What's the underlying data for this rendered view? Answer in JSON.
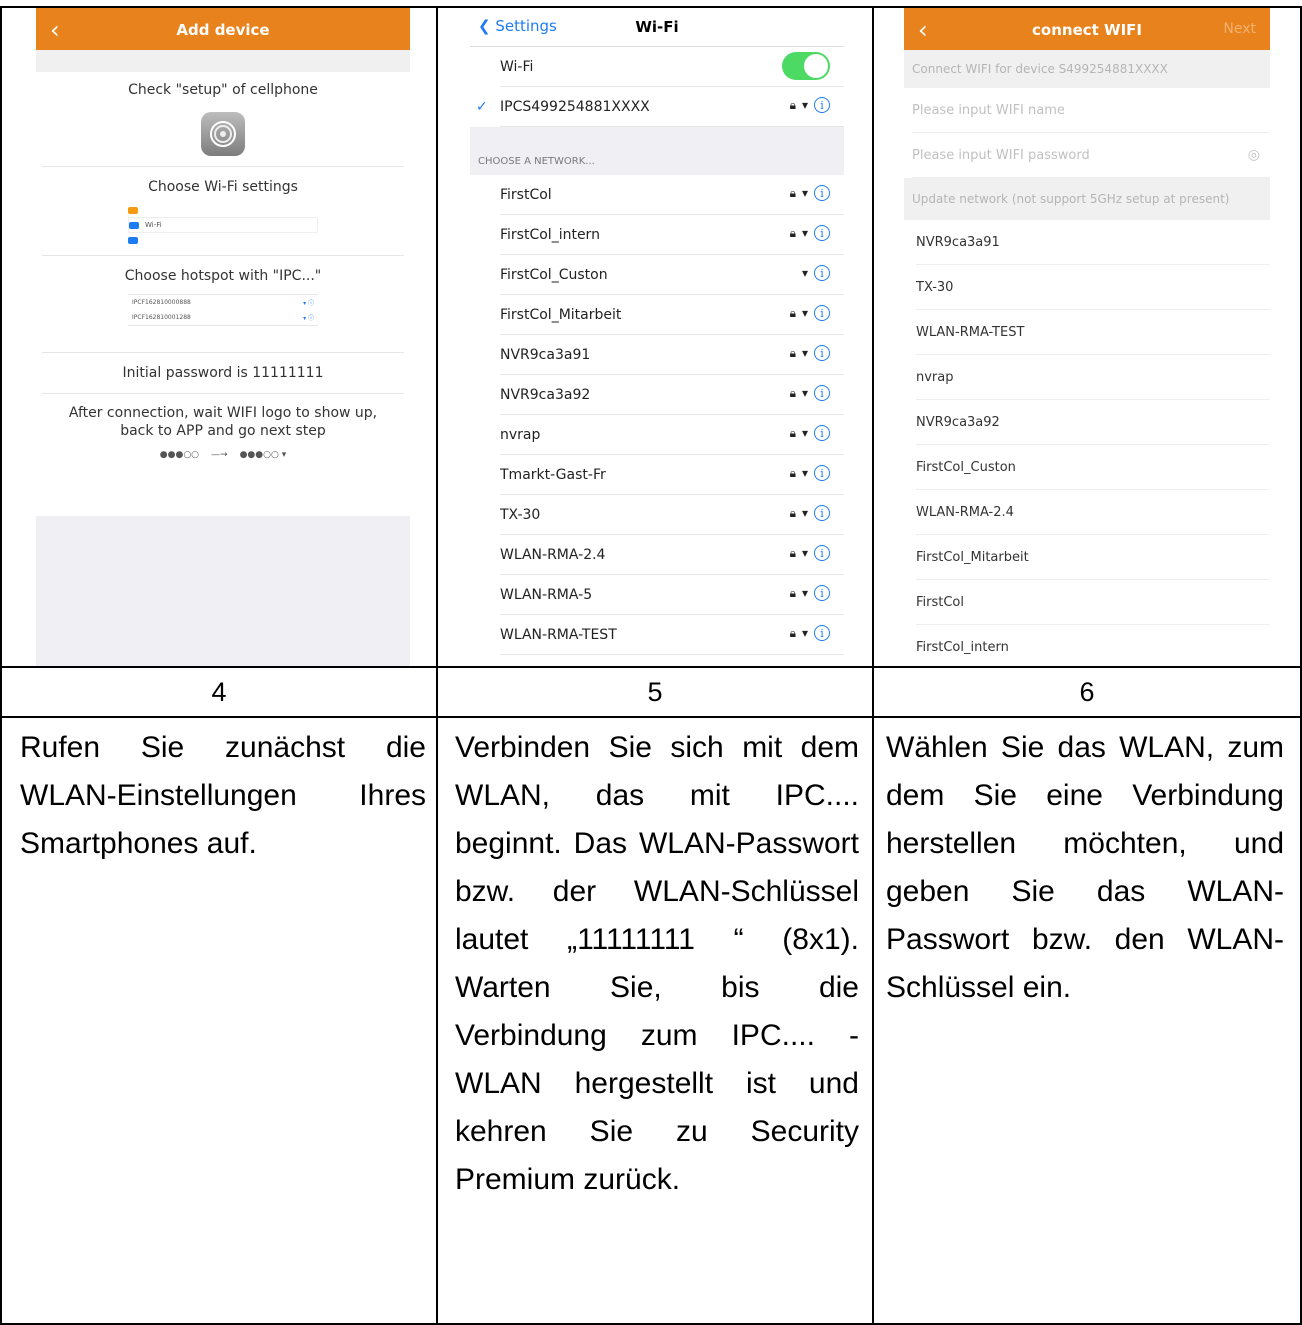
{
  "panel1": {
    "title": "Add device",
    "check_setup": "Check \"setup\" of cellphone",
    "choose_wifi": "Choose Wi-Fi settings",
    "wifi_mini_label": "Wi-Fi",
    "choose_hotspot": "Choose hotspot with \"IPC...\"",
    "hotspots": [
      "IPCF162810000888",
      "IPCF162810001288"
    ],
    "initial_password": "Initial password is 11111111",
    "after_connection": "After connection, wait WIFI logo to show up, back to APP and go next step"
  },
  "panel2": {
    "back_label": "Settings",
    "title": "Wi-Fi",
    "wifi_label": "Wi-Fi",
    "connected_network": "IPCS499254881XXXX",
    "section_header": "CHOOSE A NETWORK...",
    "networks": [
      {
        "name": "FirstCol",
        "locked": true
      },
      {
        "name": "FirstCol_intern",
        "locked": true
      },
      {
        "name": "FirstCol_Custon",
        "locked": false
      },
      {
        "name": "FirstCol_Mitarbeit",
        "locked": true
      },
      {
        "name": "NVR9ca3a91",
        "locked": true
      },
      {
        "name": "NVR9ca3a92",
        "locked": true
      },
      {
        "name": "nvrap",
        "locked": true
      },
      {
        "name": "Tmarkt-Gast-Fr",
        "locked": true
      },
      {
        "name": "TX-30",
        "locked": true
      },
      {
        "name": "WLAN-RMA-2.4",
        "locked": true
      },
      {
        "name": "WLAN-RMA-5",
        "locked": true
      },
      {
        "name": "WLAN-RMA-TEST",
        "locked": true
      }
    ]
  },
  "panel3": {
    "title": "connect WIFI",
    "next_label": "Next",
    "connect_for_device": "Connect WIFI for device S499254881XXXX",
    "wifi_name_placeholder": "Please input WIFI name",
    "wifi_password_placeholder": "Please input WIFI password",
    "update_network": "Update network (not support 5GHz setup at present)",
    "networks": [
      "NVR9ca3a91",
      "TX-30",
      "WLAN-RMA-TEST",
      "nvrap",
      "NVR9ca3a92",
      "FirstCol_Custon",
      "WLAN-RMA-2.4",
      "FirstCol_Mitarbeit",
      "FirstCol",
      "FirstCol_intern"
    ]
  },
  "steps": [
    {
      "number": "4",
      "text": "Rufen Sie zunächst die WLAN-Einstellungen Ihres Smartphones auf."
    },
    {
      "number": "5",
      "text": "Verbinden Sie sich mit dem WLAN, das mit IPC.... beginnt. Das WLAN-Passwort bzw. der WLAN-Schlüssel lautet „11111111 “ (8x1). Warten Sie, bis die Verbindung zum IPC.... -WLAN hergestellt ist und kehren Sie zu Security Premium zurück."
    },
    {
      "number": "6",
      "text": "Wählen Sie das WLAN, zum dem Sie eine Verbindung herstellen möchten, und geben Sie das WLAN-Passwort bzw. den WLAN-Schlüssel ein."
    }
  ],
  "colors": {
    "accent": "#e8821c",
    "ios_blue": "#1e7cf2",
    "toggle_green": "#4cd964"
  }
}
